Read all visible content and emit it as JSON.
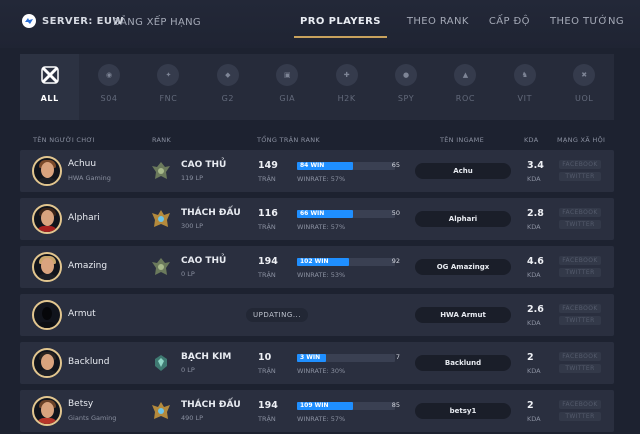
{
  "header": {
    "server_label": "SERVER: EUW",
    "rankings_label": "BẢNG XẾP HẠNG",
    "nav": [
      "PRO PLAYERS",
      "THEO RANK",
      "CẤP ĐỘ",
      "THEO TƯỚNG"
    ]
  },
  "teams": [
    {
      "name": "ALL",
      "icon": "all-logo"
    },
    {
      "name": "S04",
      "icon": "s04-logo"
    },
    {
      "name": "FNC",
      "icon": "fnc-logo"
    },
    {
      "name": "G2",
      "icon": "g2-logo"
    },
    {
      "name": "GIA",
      "icon": "gia-logo"
    },
    {
      "name": "H2K",
      "icon": "h2k-logo"
    },
    {
      "name": "SPY",
      "icon": "spy-logo"
    },
    {
      "name": "ROC",
      "icon": "roc-logo"
    },
    {
      "name": "VIT",
      "icon": "vit-logo"
    },
    {
      "name": "UOL",
      "icon": "uol-logo"
    }
  ],
  "columns": {
    "player": "TÊN NGƯỜI CHƠI",
    "rank": "RANK",
    "total": "TỔNG TRẬN RANK",
    "ingame": "TÊN INGAME",
    "kda": "KDA",
    "social": "MẠNG XÃ HỘI"
  },
  "labels": {
    "matches": "TRẬN",
    "kda": "KDA",
    "facebook": "FACEBOOK",
    "twitter": "TWITTER",
    "updating": "UPDATING..."
  },
  "players": [
    {
      "name": "Achuu",
      "team": "HWA Gaming",
      "rank": "CAO THỦ",
      "lp": "119 LP",
      "total": "149",
      "win_label": "84 WIN",
      "win_fraction": 0.57,
      "losses": "65",
      "winrate": "WINRATE: 57%",
      "ingame": "Achu",
      "kda": "3.4"
    },
    {
      "name": "Alphari",
      "team": "",
      "rank": "THÁCH ĐẤU",
      "lp": "300 LP",
      "total": "116",
      "win_label": "66 WIN",
      "win_fraction": 0.57,
      "losses": "50",
      "winrate": "WINRATE: 57%",
      "ingame": "Alphari",
      "kda": "2.8"
    },
    {
      "name": "Amazing",
      "team": "",
      "rank": "CAO THỦ",
      "lp": "0 LP",
      "total": "194",
      "win_label": "102 WIN",
      "win_fraction": 0.53,
      "losses": "92",
      "winrate": "WINRATE: 53%",
      "ingame": "OG Amazingx",
      "kda": "4.6"
    },
    {
      "name": "Armut",
      "team": "",
      "rank": "",
      "lp": "",
      "total": "",
      "win_label": "",
      "win_fraction": 0,
      "losses": "",
      "winrate": "",
      "ingame": "HWA Armut",
      "kda": "2.6",
      "updating": true
    },
    {
      "name": "Backlund",
      "team": "",
      "rank": "BẠCH KIM",
      "lp": "0 LP",
      "total": "10",
      "win_label": "3 WIN",
      "win_fraction": 0.3,
      "losses": "7",
      "winrate": "WINRATE: 30%",
      "ingame": "Backlund",
      "kda": "2"
    },
    {
      "name": "Betsy",
      "team": "Giants Gaming",
      "rank": "THÁCH ĐẤU",
      "lp": "490 LP",
      "total": "194",
      "win_label": "109 WIN",
      "win_fraction": 0.57,
      "losses": "85",
      "winrate": "WINRATE: 57%",
      "ingame": "betsy1",
      "kda": "2"
    }
  ]
}
